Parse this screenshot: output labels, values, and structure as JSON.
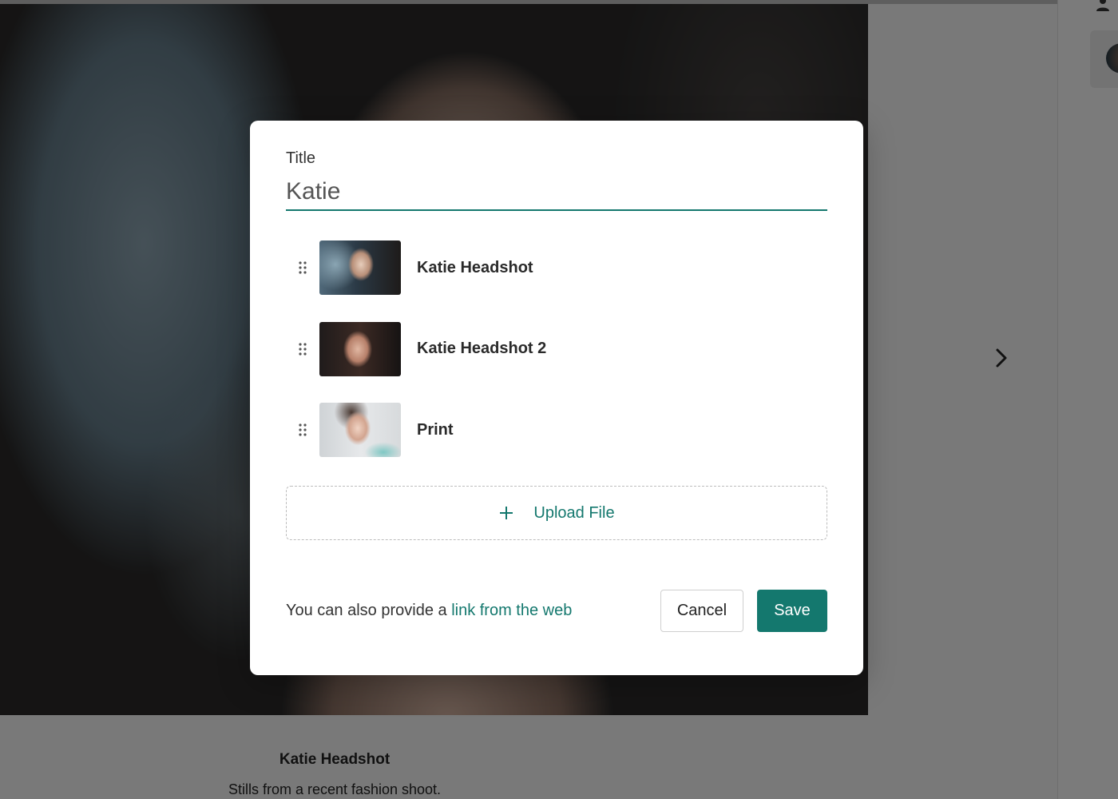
{
  "background": {
    "caption_title": "Katie Headshot",
    "caption_description": "Stills from a recent fashion shoot.",
    "next_icon": "chevron-right-icon",
    "rail_user_icon": "user-icon"
  },
  "modal": {
    "title_label": "Title",
    "title_value": "Katie",
    "files": [
      {
        "name": "Katie Headshot",
        "drag_icon": "drag-handle-icon"
      },
      {
        "name": "Katie Headshot 2",
        "drag_icon": "drag-handle-icon"
      },
      {
        "name": "Print",
        "drag_icon": "drag-handle-icon"
      }
    ],
    "upload_icon": "plus-icon",
    "upload_label": "Upload File",
    "footer_prefix": "You can also provide a ",
    "footer_link": "link from the web",
    "cancel_label": "Cancel",
    "save_label": "Save"
  },
  "colors": {
    "accent": "#14786e",
    "overlay": "rgba(0,0,0,0.5)"
  }
}
